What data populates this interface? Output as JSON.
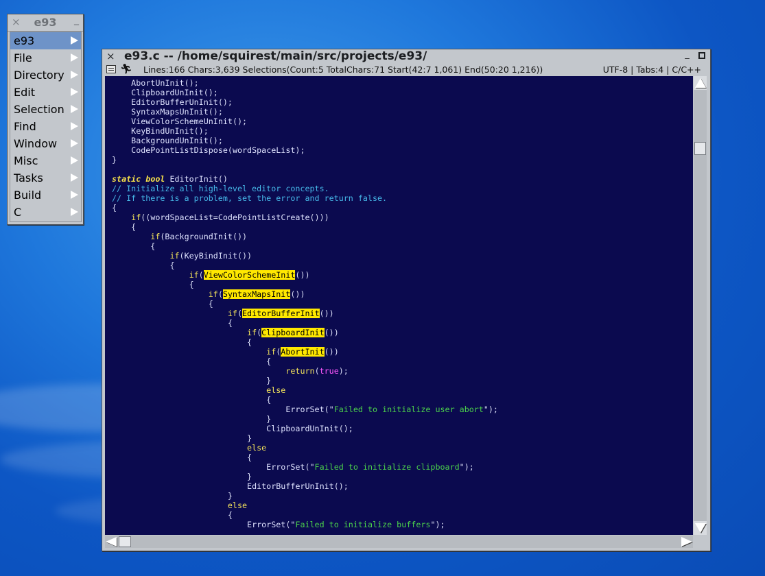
{
  "desktop": {
    "background": "#1466d2"
  },
  "menu_window": {
    "title": "e93",
    "close_glyph": "×",
    "minimize_glyph": "_",
    "items": [
      {
        "label": "e93",
        "selected": true
      },
      {
        "label": "File"
      },
      {
        "label": "Directory"
      },
      {
        "label": "Edit"
      },
      {
        "label": "Selection"
      },
      {
        "label": "Find"
      },
      {
        "label": "Window"
      },
      {
        "label": "Misc"
      },
      {
        "label": "Tasks"
      },
      {
        "label": "Build"
      },
      {
        "label": "C"
      }
    ]
  },
  "editor_window": {
    "title": "e93.c -- /home/squirest/main/src/projects/e93/",
    "close_glyph": "×",
    "minimize_glyph": "_",
    "status": {
      "info": "Lines:166 Chars:3,639 Selections(Count:5 TotalChars:71 Start(42:7 1,061) End(50:20 1,216))",
      "encoding": "UTF-8",
      "tabs": "Tabs:4",
      "language": "C/C++"
    },
    "code_lines": [
      "    AbortUnInit();",
      "    ClipboardUnInit();",
      "    EditorBufferUnInit();",
      "    SyntaxMapsUnInit();",
      "    ViewColorSchemeUnInit();",
      "    KeyBindUnInit();",
      "    BackgroundUnInit();",
      "    CodePointListDispose(wordSpaceList);",
      "}",
      "",
      "static bool EditorInit()",
      "// Initialize all high-level editor concepts.",
      "// If there is a problem, set the error and return false.",
      "{",
      "    if((wordSpaceList=CodePointListCreate()))",
      "    {",
      "        if(BackgroundInit())",
      "        {",
      "            if(KeyBindInit())",
      "            {",
      "                if(ViewColorSchemeInit())",
      "                {",
      "                    if(SyntaxMapsInit())",
      "                    {",
      "                        if(EditorBufferInit())",
      "                        {",
      "                            if(ClipboardInit())",
      "                            {",
      "                                if(AbortInit())",
      "                                {",
      "                                    return(true);",
      "                                }",
      "                                else",
      "                                {",
      "                                    ErrorSet(\"Failed to initialize user abort\");",
      "                                }",
      "                                ClipboardUnInit();",
      "                            }",
      "                            else",
      "                            {",
      "                                ErrorSet(\"Failed to initialize clipboard\");",
      "                            }",
      "                            EditorBufferUnInit();",
      "                        }",
      "                        else",
      "                        {",
      "                            ErrorSet(\"Failed to initialize buffers\");"
    ],
    "highlighted_selections": [
      "ViewColorSchemeInit",
      "SyntaxMapsInit",
      "EditorBufferInit",
      "ClipboardInit",
      "AbortInit"
    ],
    "colors": {
      "code_background": "#0b0a4f",
      "keyword": "#f3e35b",
      "comment": "#46b8e8",
      "string": "#4bd24b",
      "literal": "#ff58ff",
      "selection": "#ffe800"
    }
  }
}
